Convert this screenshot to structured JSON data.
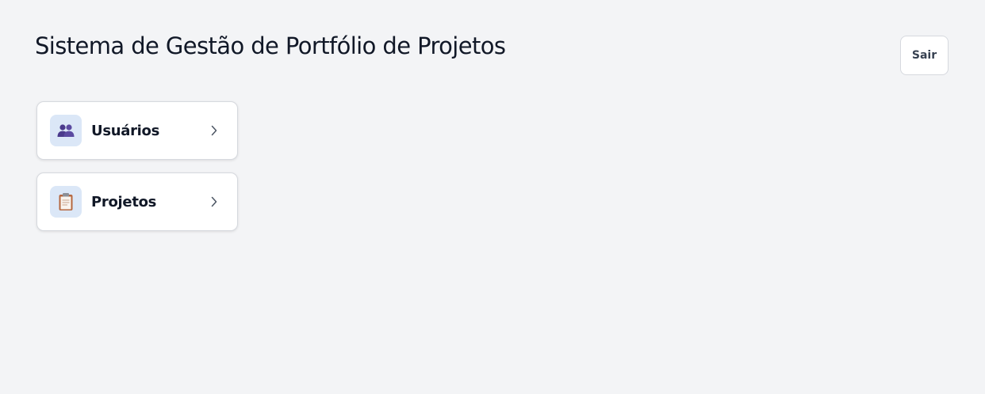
{
  "header": {
    "title": "Sistema de Gestão de Portfólio de Projetos",
    "logout_label": "Sair"
  },
  "menu": {
    "items": [
      {
        "label": "Usuários",
        "icon": "users-icon"
      },
      {
        "label": "Projetos",
        "icon": "clipboard-icon"
      }
    ]
  },
  "colors": {
    "background": "#f3f4f6",
    "card_icon_background": "#dbe7f7",
    "users_icon": "#4a3a8c",
    "text": "#111827"
  }
}
